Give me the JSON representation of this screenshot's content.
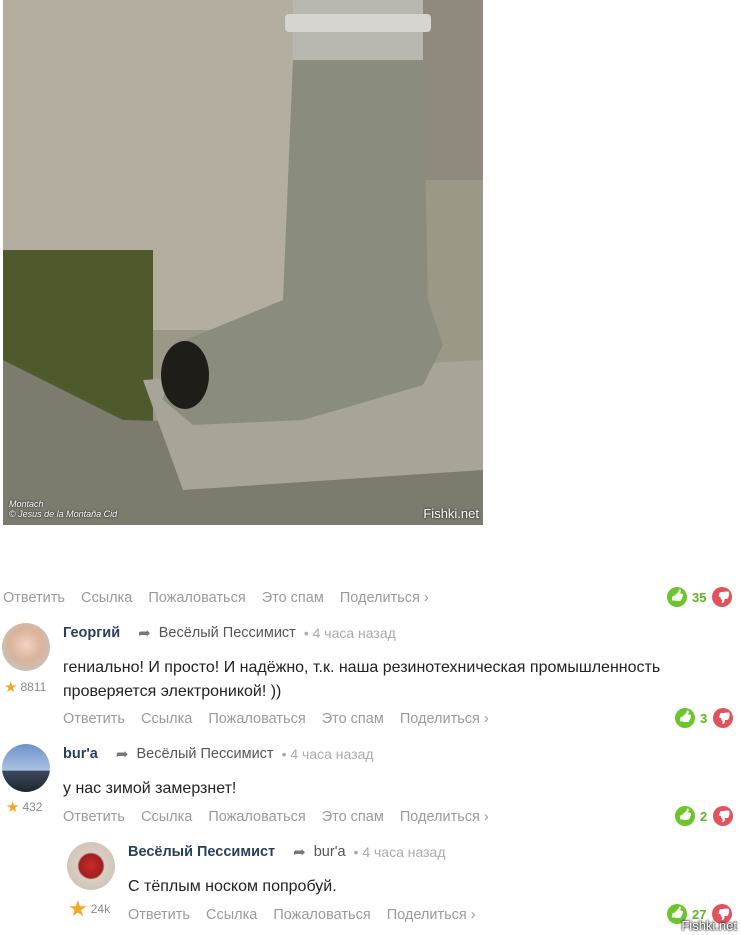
{
  "photo": {
    "watermark": "Fishki.net",
    "credit": "Montach\n© Jesus de la Montaña Cid"
  },
  "actions_main": [
    "Ответить",
    "Ссылка",
    "Пожаловаться",
    "Это спам",
    "Поделиться ›"
  ],
  "post_votes": "35",
  "comments": [
    {
      "author": "Георгий",
      "reply_to": "Весёлый Пессимист",
      "time": "• 4 часа назад",
      "rating": "8811",
      "text": "гениально! И просто! И надёжно, т.к. наша резинотехническая промышленность проверяется электроникой! ))",
      "actions": [
        "Ответить",
        "Ссылка",
        "Пожаловаться",
        "Это спам",
        "Поделиться ›"
      ],
      "votes": "3"
    },
    {
      "author": "bur'a",
      "reply_to": "Весёлый Пессимист",
      "time": "• 4 часа назад",
      "rating": "432",
      "text": "у нас зимой замерзнет!",
      "actions": [
        "Ответить",
        "Ссылка",
        "Пожаловаться",
        "Это спам",
        "Поделиться ›"
      ],
      "votes": "2"
    },
    {
      "author": "Весёлый Пессимист",
      "reply_to": "bur'a",
      "time": "• 4 часа назад",
      "rating": "24k",
      "text": "С тёплым носком попробуй.",
      "actions": [
        "Ответить",
        "Ссылка",
        "Пожаловаться",
        "Поделиться ›"
      ],
      "votes": "27"
    }
  ],
  "footer_watermark": "Fishki.net",
  "colors": {
    "like": "#6cc52a",
    "dislike": "#e2525d",
    "author": "#2a3f5a"
  }
}
